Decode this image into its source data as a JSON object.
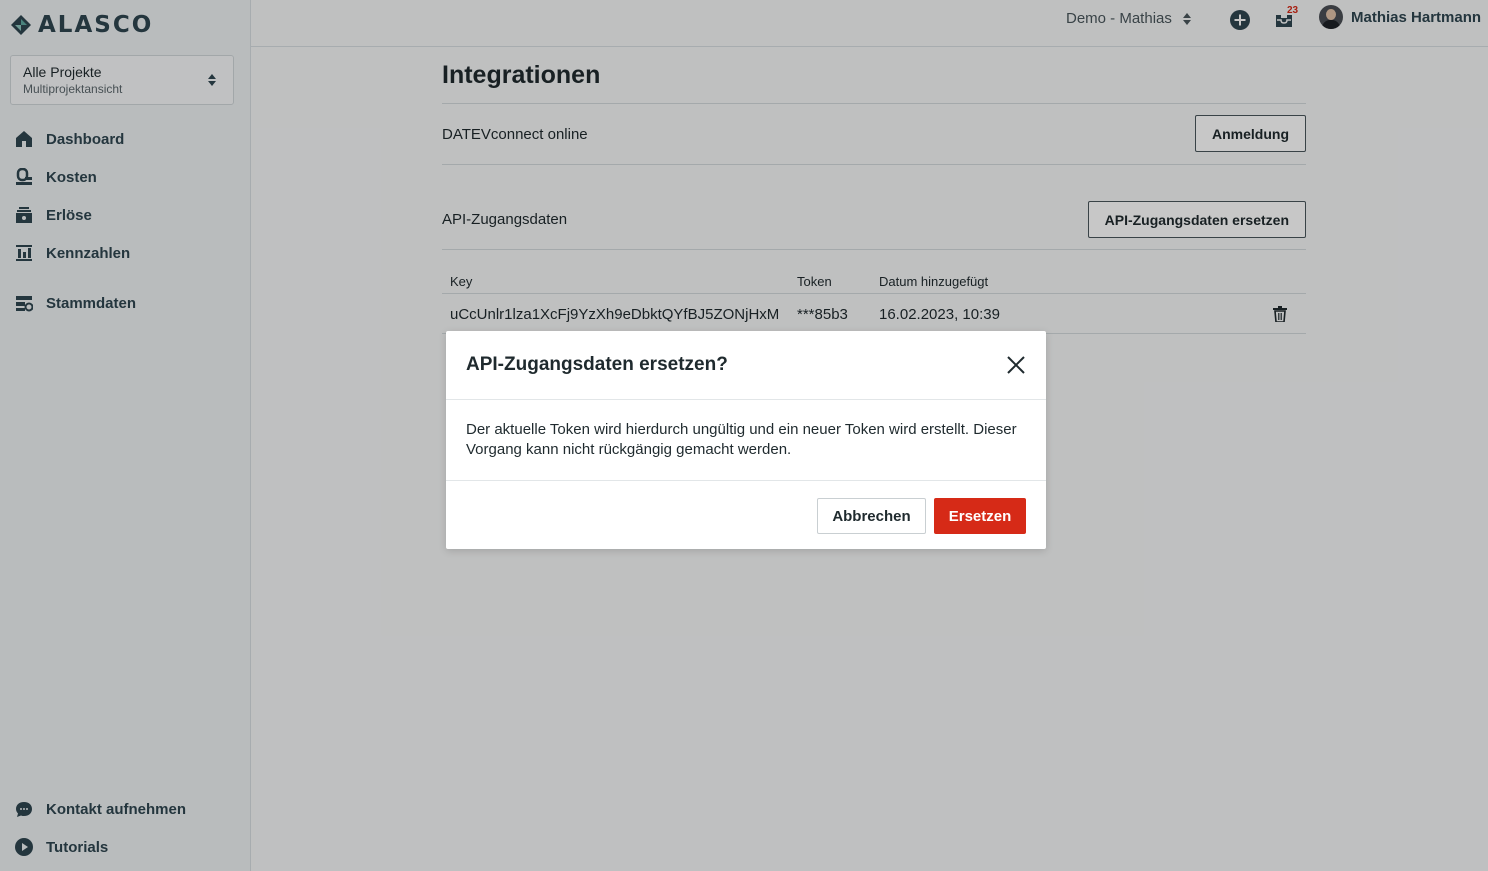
{
  "colors": {
    "accent": "#2f4650",
    "danger": "#d62a17",
    "sidebar_bg": "#eef1f3"
  },
  "brand": {
    "name": "ALASCO",
    "icon": "alasco-logo-icon"
  },
  "project_selector": {
    "title": "Alle Projekte",
    "subtitle": "Multiprojektansicht"
  },
  "sidebar": {
    "items": [
      {
        "label": "Dashboard",
        "icon": "home-icon"
      },
      {
        "label": "Kosten",
        "icon": "costs-icon"
      },
      {
        "label": "Erlöse",
        "icon": "revenue-icon"
      },
      {
        "label": "Kennzahlen",
        "icon": "chart-icon"
      },
      {
        "label": "Stammdaten",
        "icon": "master-data-icon"
      }
    ],
    "bottom_items": [
      {
        "label": "Kontakt aufnehmen",
        "icon": "chat-icon"
      },
      {
        "label": "Tutorials",
        "icon": "play-icon"
      }
    ]
  },
  "header": {
    "account": "Demo - Mathias",
    "inbox_count": "23",
    "user_name": "Mathias Hartmann"
  },
  "main": {
    "title": "Integrationen",
    "datev": {
      "label": "DATEVconnect online",
      "button": "Anmeldung"
    },
    "api": {
      "label": "API-Zugangsdaten",
      "button": "API-Zugangsdaten ersetzen"
    },
    "table": {
      "columns": [
        "Key",
        "Token",
        "Datum hinzugefügt"
      ],
      "rows": [
        {
          "key": "uCcUnlr1lza1XcFj9YzXh9eDbktQYfBJ5ZONjHxM",
          "token": "***85b3",
          "date": "16.02.2023, 10:39"
        }
      ]
    }
  },
  "modal": {
    "title": "API-Zugangsdaten ersetzen?",
    "body": "Der aktuelle Token wird hierdurch ungültig und ein neuer Token wird erstellt. Dieser Vorgang kann nicht rückgängig gemacht werden.",
    "cancel": "Abbrechen",
    "confirm": "Ersetzen"
  }
}
